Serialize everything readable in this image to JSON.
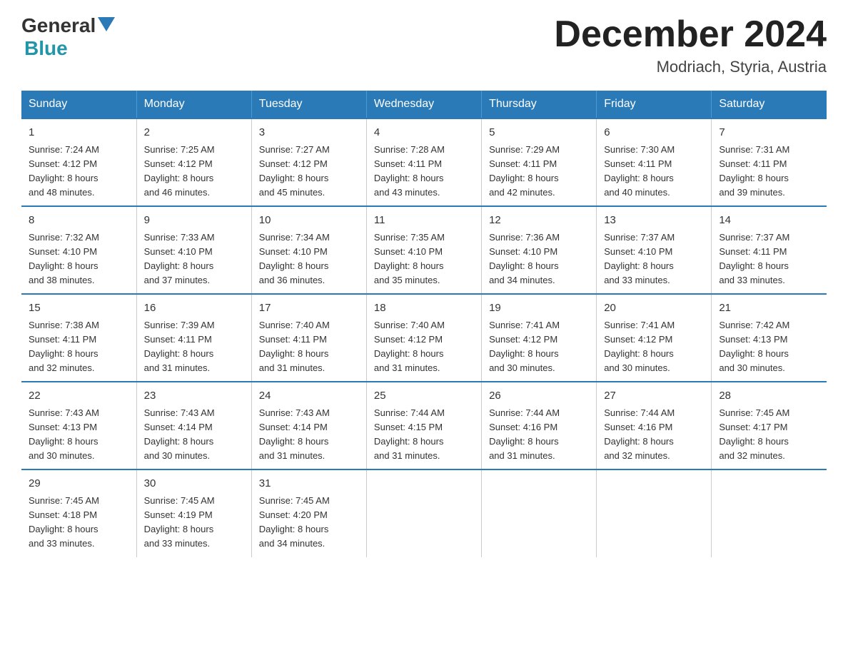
{
  "header": {
    "logo_general": "General",
    "logo_blue": "Blue",
    "month_year": "December 2024",
    "location": "Modriach, Styria, Austria"
  },
  "days_of_week": [
    "Sunday",
    "Monday",
    "Tuesday",
    "Wednesday",
    "Thursday",
    "Friday",
    "Saturday"
  ],
  "weeks": [
    [
      {
        "day": "1",
        "sunrise": "7:24 AM",
        "sunset": "4:12 PM",
        "daylight": "8 hours and 48 minutes."
      },
      {
        "day": "2",
        "sunrise": "7:25 AM",
        "sunset": "4:12 PM",
        "daylight": "8 hours and 46 minutes."
      },
      {
        "day": "3",
        "sunrise": "7:27 AM",
        "sunset": "4:12 PM",
        "daylight": "8 hours and 45 minutes."
      },
      {
        "day": "4",
        "sunrise": "7:28 AM",
        "sunset": "4:11 PM",
        "daylight": "8 hours and 43 minutes."
      },
      {
        "day": "5",
        "sunrise": "7:29 AM",
        "sunset": "4:11 PM",
        "daylight": "8 hours and 42 minutes."
      },
      {
        "day": "6",
        "sunrise": "7:30 AM",
        "sunset": "4:11 PM",
        "daylight": "8 hours and 40 minutes."
      },
      {
        "day": "7",
        "sunrise": "7:31 AM",
        "sunset": "4:11 PM",
        "daylight": "8 hours and 39 minutes."
      }
    ],
    [
      {
        "day": "8",
        "sunrise": "7:32 AM",
        "sunset": "4:10 PM",
        "daylight": "8 hours and 38 minutes."
      },
      {
        "day": "9",
        "sunrise": "7:33 AM",
        "sunset": "4:10 PM",
        "daylight": "8 hours and 37 minutes."
      },
      {
        "day": "10",
        "sunrise": "7:34 AM",
        "sunset": "4:10 PM",
        "daylight": "8 hours and 36 minutes."
      },
      {
        "day": "11",
        "sunrise": "7:35 AM",
        "sunset": "4:10 PM",
        "daylight": "8 hours and 35 minutes."
      },
      {
        "day": "12",
        "sunrise": "7:36 AM",
        "sunset": "4:10 PM",
        "daylight": "8 hours and 34 minutes."
      },
      {
        "day": "13",
        "sunrise": "7:37 AM",
        "sunset": "4:10 PM",
        "daylight": "8 hours and 33 minutes."
      },
      {
        "day": "14",
        "sunrise": "7:37 AM",
        "sunset": "4:11 PM",
        "daylight": "8 hours and 33 minutes."
      }
    ],
    [
      {
        "day": "15",
        "sunrise": "7:38 AM",
        "sunset": "4:11 PM",
        "daylight": "8 hours and 32 minutes."
      },
      {
        "day": "16",
        "sunrise": "7:39 AM",
        "sunset": "4:11 PM",
        "daylight": "8 hours and 31 minutes."
      },
      {
        "day": "17",
        "sunrise": "7:40 AM",
        "sunset": "4:11 PM",
        "daylight": "8 hours and 31 minutes."
      },
      {
        "day": "18",
        "sunrise": "7:40 AM",
        "sunset": "4:12 PM",
        "daylight": "8 hours and 31 minutes."
      },
      {
        "day": "19",
        "sunrise": "7:41 AM",
        "sunset": "4:12 PM",
        "daylight": "8 hours and 30 minutes."
      },
      {
        "day": "20",
        "sunrise": "7:41 AM",
        "sunset": "4:12 PM",
        "daylight": "8 hours and 30 minutes."
      },
      {
        "day": "21",
        "sunrise": "7:42 AM",
        "sunset": "4:13 PM",
        "daylight": "8 hours and 30 minutes."
      }
    ],
    [
      {
        "day": "22",
        "sunrise": "7:43 AM",
        "sunset": "4:13 PM",
        "daylight": "8 hours and 30 minutes."
      },
      {
        "day": "23",
        "sunrise": "7:43 AM",
        "sunset": "4:14 PM",
        "daylight": "8 hours and 30 minutes."
      },
      {
        "day": "24",
        "sunrise": "7:43 AM",
        "sunset": "4:14 PM",
        "daylight": "8 hours and 31 minutes."
      },
      {
        "day": "25",
        "sunrise": "7:44 AM",
        "sunset": "4:15 PM",
        "daylight": "8 hours and 31 minutes."
      },
      {
        "day": "26",
        "sunrise": "7:44 AM",
        "sunset": "4:16 PM",
        "daylight": "8 hours and 31 minutes."
      },
      {
        "day": "27",
        "sunrise": "7:44 AM",
        "sunset": "4:16 PM",
        "daylight": "8 hours and 32 minutes."
      },
      {
        "day": "28",
        "sunrise": "7:45 AM",
        "sunset": "4:17 PM",
        "daylight": "8 hours and 32 minutes."
      }
    ],
    [
      {
        "day": "29",
        "sunrise": "7:45 AM",
        "sunset": "4:18 PM",
        "daylight": "8 hours and 33 minutes."
      },
      {
        "day": "30",
        "sunrise": "7:45 AM",
        "sunset": "4:19 PM",
        "daylight": "8 hours and 33 minutes."
      },
      {
        "day": "31",
        "sunrise": "7:45 AM",
        "sunset": "4:20 PM",
        "daylight": "8 hours and 34 minutes."
      },
      null,
      null,
      null,
      null
    ]
  ],
  "labels": {
    "sunrise": "Sunrise:",
    "sunset": "Sunset:",
    "daylight": "Daylight:"
  }
}
